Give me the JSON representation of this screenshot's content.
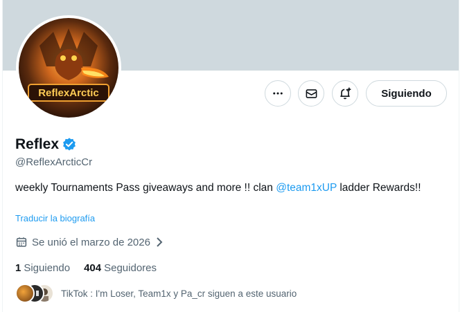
{
  "profile": {
    "avatar_text": "ReflexArctic",
    "name": "Reflex",
    "handle": "@ReflexArcticCr",
    "bio_before": "weekly Tournaments Pass giveaways and more !! clan ",
    "bio_mention": "@team1xUP",
    "bio_after": " ladder Rewards!!",
    "translate_label": "Traducir la biografía",
    "joined": "Se unió el marzo de 2026"
  },
  "actions": {
    "follow_label": "Siguiendo"
  },
  "stats": {
    "following_count": "1",
    "following_label": "Siguiendo",
    "followers_count": "404",
    "followers_label": "Seguidores"
  },
  "known_followers": {
    "text": "TikTok : I'm Loser, Team1x y Pa_cr siguen a este usuario"
  },
  "icons": {
    "more": "more-icon",
    "message": "envelope-icon",
    "notify": "bell-plus-icon",
    "verified": "verified-badge-icon",
    "calendar": "calendar-icon",
    "chevron": "chevron-right-icon"
  },
  "colors": {
    "accent": "#1d9bf0",
    "banner": "#cfd9de",
    "text": "#0f1419",
    "muted": "#536471"
  }
}
